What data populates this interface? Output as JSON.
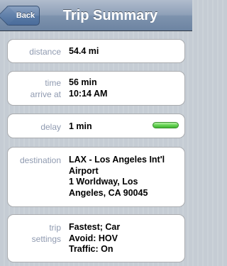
{
  "nav": {
    "back_label": "Back",
    "title": "Trip Summary"
  },
  "distance": {
    "label": "distance",
    "value": "54.4 mi"
  },
  "time": {
    "time_label": "time",
    "time_value": "56 min",
    "arrive_label": "arrive at",
    "arrive_value": "10:14 AM"
  },
  "delay": {
    "label": "delay",
    "value": "1 min",
    "bar_color": "#4cc23a"
  },
  "destination": {
    "label": "destination",
    "lines": [
      "LAX - Los Angeles Int'l",
      "Airport",
      "1 Worldway, Los",
      "Angeles, CA 90045"
    ]
  },
  "trip_settings": {
    "label_line1": "trip",
    "label_line2": "settings",
    "lines": [
      "Fastest; Car",
      "Avoid: HOV",
      "Traffic: On"
    ]
  }
}
